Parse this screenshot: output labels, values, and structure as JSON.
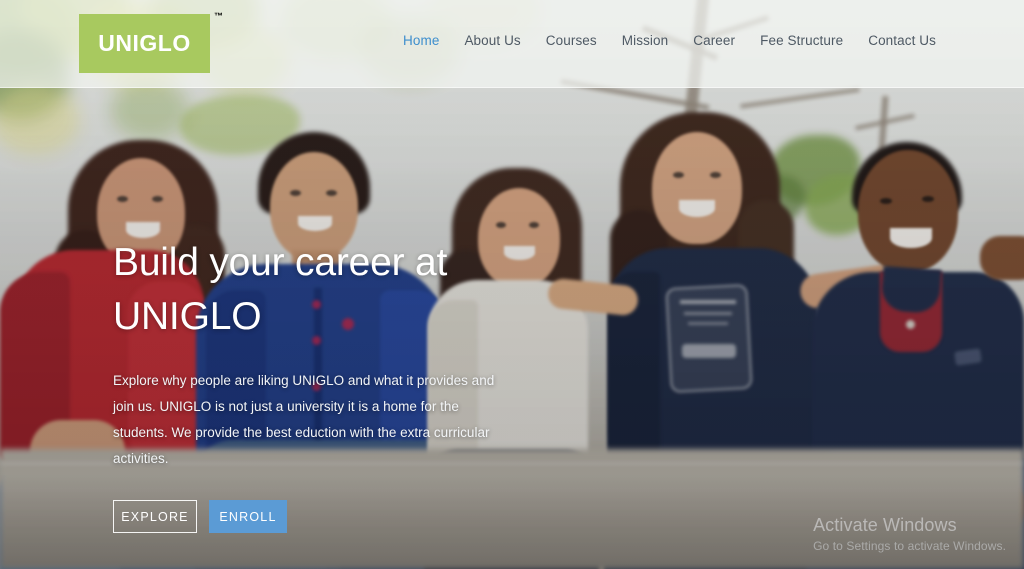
{
  "header": {
    "logo": {
      "name": "UNIGLO",
      "trademark": "™",
      "background_color": "#a8c95f"
    },
    "nav": {
      "items": [
        {
          "label": "Home",
          "active": true
        },
        {
          "label": "About Us",
          "active": false
        },
        {
          "label": "Courses",
          "active": false
        },
        {
          "label": "Mission",
          "active": false
        },
        {
          "label": "Career",
          "active": false
        },
        {
          "label": "Fee Structure",
          "active": false
        },
        {
          "label": "Contact Us",
          "active": false
        }
      ],
      "active_color": "#3d8ecd",
      "inactive_color": "#4e5964"
    }
  },
  "hero": {
    "title_line_1": "Build your career at",
    "title_line_2": "UNIGLO",
    "paragraph": "Explore why people are liking UNIGLO and what it provides and join us. UNIGLO is not just a university it is a home for the students. We provide the best eduction with the extra curricular activities.",
    "buttons": {
      "explore": "EXPLORE",
      "enroll": "ENROLL",
      "enroll_color": "#5b9bd5"
    }
  },
  "watermark": {
    "title": "Activate Windows",
    "subtitle": "Go to Settings to activate Windows."
  }
}
